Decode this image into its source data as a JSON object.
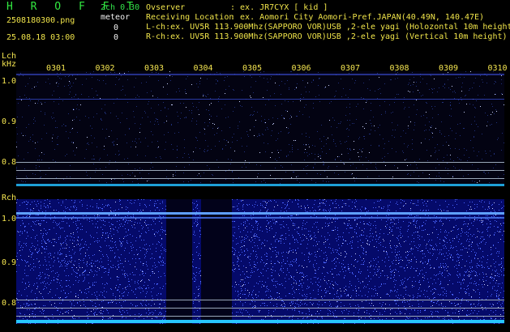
{
  "header": {
    "title": "H R O F F T",
    "channel": "2ch 0.30",
    "mode": "meteor",
    "file": "2508180300.png",
    "count_l": "0",
    "datetime": "25.08.18 03:00",
    "count_r": "0",
    "observer_label": "Ovserver",
    "observer_value": ": ex. JR7CYX [ kid ]",
    "location_label": "Receiving Location",
    "location_value": ": ex. Aomori City Aomori-Pref.JAPAN(40.49N, 140.47E)",
    "lch_info": "L-ch:ex. UV5R 113.900Mhz(SAPPORO VOR)USB ,2-ele yagi (Holozontal 10m height)",
    "rch_info": "R-ch:ex. UV5R 113.900Mhz(SAPPORO VOR)USB ,2-ele yagi (Vertical 10m height)"
  },
  "lch": {
    "label": "Lch",
    "unit": "kHz",
    "ticks": [
      "1.0",
      "0.9",
      "0.8"
    ]
  },
  "rch": {
    "label": "Rch",
    "ticks": [
      "1.0",
      "0.9",
      "0.8"
    ]
  },
  "columns": [
    "0301",
    "0302",
    "0303",
    "0304",
    "0305",
    "0306",
    "0307",
    "0308",
    "0309",
    "0310"
  ],
  "colors": {
    "signal_band": "#3c6fe8",
    "noise_dot": "#4a64ff",
    "baseline": "#29c8ff",
    "text_yellow": "#f4e550",
    "text_green": "#33e24a"
  }
}
